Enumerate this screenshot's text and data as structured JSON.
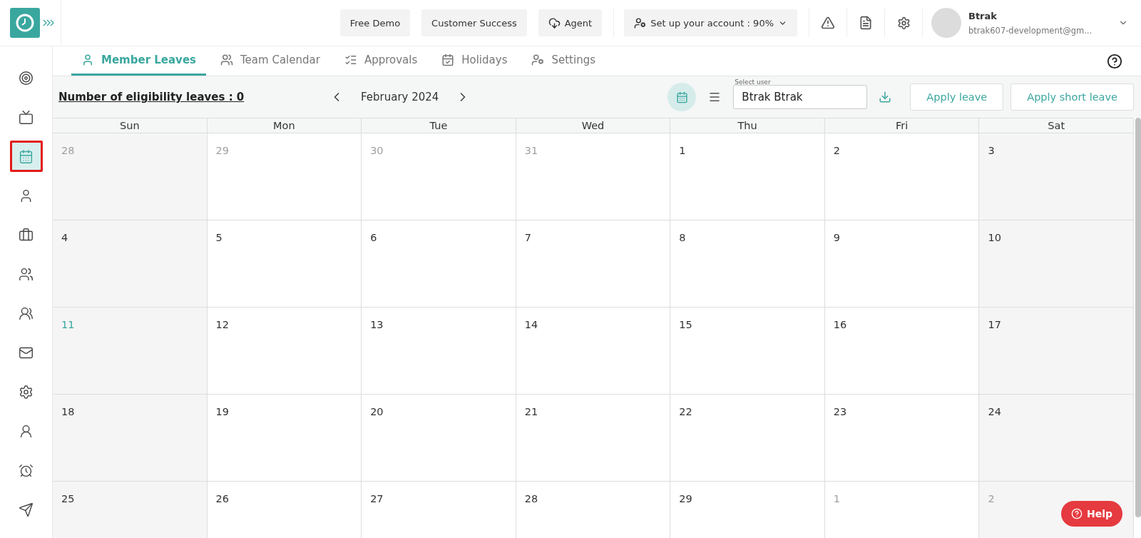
{
  "topbar": {
    "buttons": [
      {
        "label": "Free Demo",
        "kind": "plain"
      },
      {
        "label": "Customer Success",
        "kind": "plain"
      },
      {
        "label": "Agent",
        "kind": "agent"
      }
    ],
    "setup": {
      "label": "Set up your account : 90%"
    },
    "user": {
      "name": "Btrak",
      "email": "btrak607-development@gm..."
    }
  },
  "sidebar": {
    "items": [
      {
        "kind": "target",
        "selected": false
      },
      {
        "kind": "tv",
        "selected": false
      },
      {
        "kind": "calendar",
        "selected": true
      },
      {
        "kind": "user",
        "selected": false
      },
      {
        "kind": "briefcase",
        "selected": false
      },
      {
        "kind": "users",
        "selected": false
      },
      {
        "kind": "group",
        "selected": false
      },
      {
        "kind": "mail",
        "selected": false
      },
      {
        "kind": "gear",
        "selected": false
      },
      {
        "kind": "person",
        "selected": false
      },
      {
        "kind": "alarm",
        "selected": false
      },
      {
        "kind": "send",
        "selected": false
      }
    ]
  },
  "tabs": [
    {
      "label": "Member Leaves",
      "kind": "user",
      "selected": true
    },
    {
      "label": "Team Calendar",
      "kind": "team",
      "selected": false
    },
    {
      "label": "Approvals",
      "kind": "approvals",
      "selected": false
    },
    {
      "label": "Holidays",
      "kind": "holidays",
      "selected": false
    },
    {
      "label": "Settings",
      "kind": "settings",
      "selected": false
    }
  ],
  "toolbar": {
    "eligibility": "Number of eligibility leaves : 0",
    "month": "February 2024",
    "view_buttons": [
      {
        "kind": "calendar",
        "selected": true
      },
      {
        "kind": "list",
        "selected": false
      }
    ],
    "user_field": {
      "label": "Select user",
      "value": "Btrak Btrak"
    },
    "buttons": [
      "Apply leave",
      "Apply short leave"
    ]
  },
  "calendar": {
    "weekdays": [
      "Sun",
      "Mon",
      "Tue",
      "Wed",
      "Thu",
      "Fri",
      "Sat"
    ],
    "weeks": [
      [
        {
          "day": "28",
          "in_month": false,
          "today": false
        },
        {
          "day": "29",
          "in_month": false,
          "today": false
        },
        {
          "day": "30",
          "in_month": false,
          "today": false
        },
        {
          "day": "31",
          "in_month": false,
          "today": false
        },
        {
          "day": "1",
          "in_month": true,
          "today": false
        },
        {
          "day": "2",
          "in_month": true,
          "today": false
        },
        {
          "day": "3",
          "in_month": true,
          "today": false
        }
      ],
      [
        {
          "day": "4",
          "in_month": true,
          "today": false
        },
        {
          "day": "5",
          "in_month": true,
          "today": false
        },
        {
          "day": "6",
          "in_month": true,
          "today": false
        },
        {
          "day": "7",
          "in_month": true,
          "today": false
        },
        {
          "day": "8",
          "in_month": true,
          "today": false
        },
        {
          "day": "9",
          "in_month": true,
          "today": false
        },
        {
          "day": "10",
          "in_month": true,
          "today": false
        }
      ],
      [
        {
          "day": "11",
          "in_month": true,
          "today": true
        },
        {
          "day": "12",
          "in_month": true,
          "today": false
        },
        {
          "day": "13",
          "in_month": true,
          "today": false
        },
        {
          "day": "14",
          "in_month": true,
          "today": false
        },
        {
          "day": "15",
          "in_month": true,
          "today": false
        },
        {
          "day": "16",
          "in_month": true,
          "today": false
        },
        {
          "day": "17",
          "in_month": true,
          "today": false
        }
      ],
      [
        {
          "day": "18",
          "in_month": true,
          "today": false
        },
        {
          "day": "19",
          "in_month": true,
          "today": false
        },
        {
          "day": "20",
          "in_month": true,
          "today": false
        },
        {
          "day": "21",
          "in_month": true,
          "today": false
        },
        {
          "day": "22",
          "in_month": true,
          "today": false
        },
        {
          "day": "23",
          "in_month": true,
          "today": false
        },
        {
          "day": "24",
          "in_month": true,
          "today": false
        }
      ],
      [
        {
          "day": "25",
          "in_month": true,
          "today": false
        },
        {
          "day": "26",
          "in_month": true,
          "today": false
        },
        {
          "day": "27",
          "in_month": true,
          "today": false
        },
        {
          "day": "28",
          "in_month": true,
          "today": false
        },
        {
          "day": "29",
          "in_month": true,
          "today": false
        },
        {
          "day": "1",
          "in_month": false,
          "today": false
        },
        {
          "day": "2",
          "in_month": false,
          "today": false
        }
      ]
    ]
  },
  "help": {
    "label": "Help"
  }
}
